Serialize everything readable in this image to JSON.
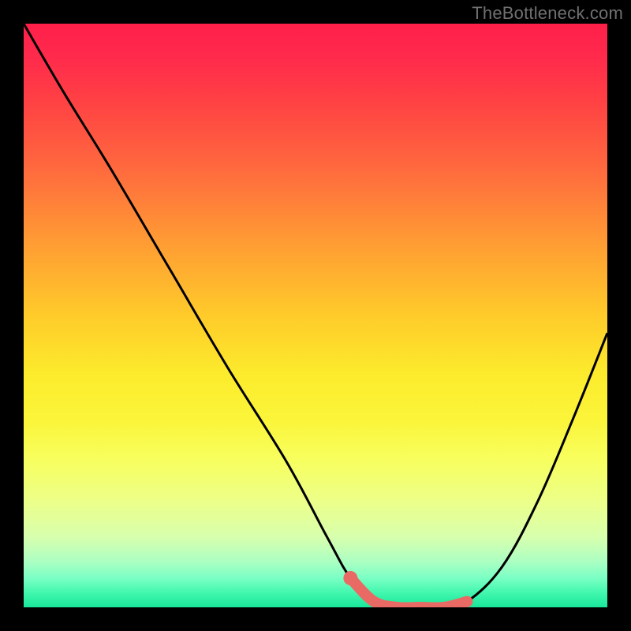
{
  "attribution": "TheBottleneck.com",
  "colors": {
    "frame": "#000000",
    "curve": "#000000",
    "marker_fill": "#e96a64",
    "marker_stroke": "#e96a64"
  },
  "chart_data": {
    "type": "line",
    "title": "",
    "xlabel": "",
    "ylabel": "",
    "xlim": [
      0,
      100
    ],
    "ylim": [
      0,
      100
    ],
    "grid": false,
    "legend": false,
    "series": [
      {
        "name": "bottleneck-curve",
        "x": [
          0,
          7,
          15,
          25,
          35,
          45,
          52,
          56,
          60,
          64,
          68,
          72,
          76,
          82,
          88,
          94,
          100
        ],
        "y": [
          100,
          88,
          75,
          58,
          41,
          25,
          12,
          5,
          1,
          0,
          0,
          0,
          1,
          7,
          18,
          32,
          47
        ]
      }
    ],
    "markers": {
      "name": "highlight-segment",
      "x": [
        56,
        60,
        64,
        68,
        72,
        76
      ],
      "y": [
        5,
        1,
        0,
        0,
        0,
        1
      ]
    }
  }
}
